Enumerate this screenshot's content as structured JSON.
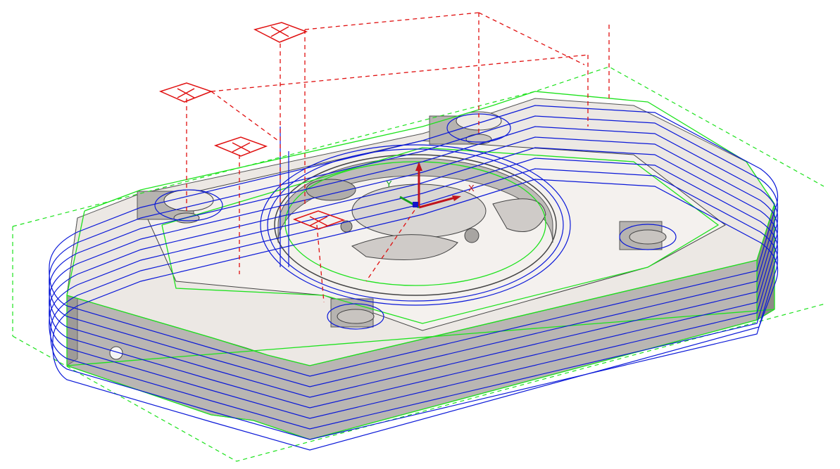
{
  "view": {
    "type": "CAM toolpath preview (isometric)",
    "background": "#ffffff"
  },
  "colors": {
    "toolpath": "#0a18d8",
    "stock_boundary": "#1de21d",
    "rapid_moves": "#e01010",
    "part_wall": "#b9b6b3",
    "part_wall_shadow": "#8d8a87",
    "part_floor": "#ece8e4",
    "axis_x": "#c0141c",
    "axis_y": "#14a01e",
    "axis_z": "#1414c8"
  },
  "triad": {
    "x_label": "X",
    "y_label": "Y"
  },
  "icons": [
    "part-model-icon",
    "toolpath-lines-icon",
    "stock-boundary-icon",
    "rapid-move-icon",
    "plunge-marker-icon",
    "coordinate-triad-icon"
  ]
}
